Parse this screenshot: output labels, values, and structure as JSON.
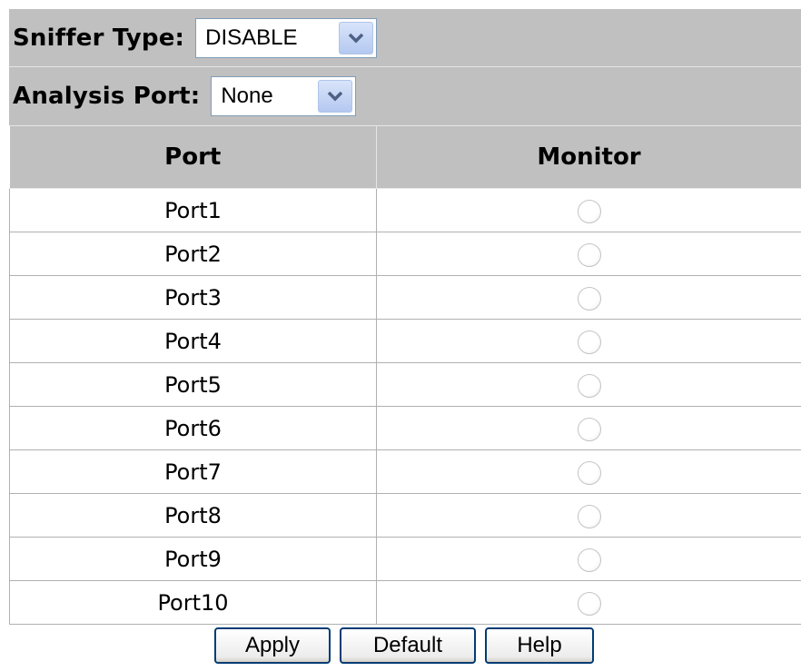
{
  "sniffer": {
    "label": "Sniffer Type:",
    "value": "DISABLE"
  },
  "analysis": {
    "label": "Analysis Port:",
    "value": "None"
  },
  "table": {
    "headers": [
      "Port",
      "Monitor"
    ],
    "rows": [
      {
        "port": "Port1",
        "monitor_selected": false
      },
      {
        "port": "Port2",
        "monitor_selected": false
      },
      {
        "port": "Port3",
        "monitor_selected": false
      },
      {
        "port": "Port4",
        "monitor_selected": false
      },
      {
        "port": "Port5",
        "monitor_selected": false
      },
      {
        "port": "Port6",
        "monitor_selected": false
      },
      {
        "port": "Port7",
        "monitor_selected": false
      },
      {
        "port": "Port8",
        "monitor_selected": false
      },
      {
        "port": "Port9",
        "monitor_selected": false
      },
      {
        "port": "Port10",
        "monitor_selected": false
      }
    ]
  },
  "buttons": {
    "apply": "Apply",
    "default": "Default",
    "help": "Help"
  },
  "colors": {
    "header_bg": "#c0c0c0",
    "button_border": "#003c74",
    "dropdown_arrow": "#4d6185"
  }
}
